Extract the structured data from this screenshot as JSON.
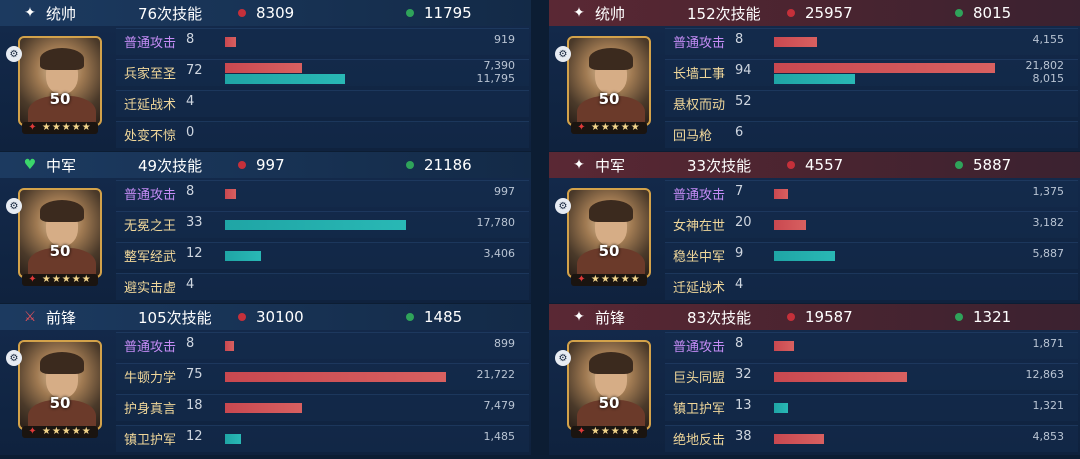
{
  "left": {
    "sections": [
      {
        "role": "统帅",
        "role_icon": "sparkle-icon",
        "skills_text": "76次技能",
        "damage": "8309",
        "heal": "11795",
        "level": "50",
        "stars": "★★★★★",
        "skills": [
          {
            "name": "普通攻击",
            "count": "8",
            "damage": "919",
            "heal": null,
            "damage_pct": 0.05,
            "heal_pct": 0,
            "style": "basic"
          },
          {
            "name": "兵家至圣",
            "count": "72",
            "damage": "7,390",
            "heal": "11,795",
            "damage_pct": 0.34,
            "heal_pct": 0.53,
            "style": "gold"
          },
          {
            "name": "迁延战术",
            "count": "4",
            "damage": null,
            "heal": null,
            "damage_pct": 0,
            "heal_pct": 0,
            "style": "gold"
          },
          {
            "name": "处变不惊",
            "count": "0",
            "damage": null,
            "heal": null,
            "damage_pct": 0,
            "heal_pct": 0,
            "style": "gold"
          }
        ]
      },
      {
        "role": "中军",
        "role_icon": "green-shield-icon",
        "skills_text": "49次技能",
        "damage": "997",
        "heal": "21186",
        "level": "50",
        "stars": "★★★★★",
        "skills": [
          {
            "name": "普通攻击",
            "count": "8",
            "damage": "997",
            "heal": null,
            "damage_pct": 0.05,
            "heal_pct": 0,
            "style": "basic"
          },
          {
            "name": "无冕之王",
            "count": "33",
            "damage": null,
            "heal": "17,780",
            "damage_pct": 0,
            "heal_pct": 0.8,
            "style": "gold"
          },
          {
            "name": "整军经武",
            "count": "12",
            "damage": null,
            "heal": "3,406",
            "damage_pct": 0,
            "heal_pct": 0.16,
            "style": "gold"
          },
          {
            "name": "避实击虚",
            "count": "4",
            "damage": null,
            "heal": null,
            "damage_pct": 0,
            "heal_pct": 0,
            "style": "gold"
          }
        ]
      },
      {
        "role": "前锋",
        "role_icon": "red-sword-icon",
        "skills_text": "105次技能",
        "damage": "30100",
        "heal": "1485",
        "level": "50",
        "stars": "★★★★★",
        "skills": [
          {
            "name": "普通攻击",
            "count": "8",
            "damage": "899",
            "heal": null,
            "damage_pct": 0.04,
            "heal_pct": 0,
            "style": "basic"
          },
          {
            "name": "牛顿力学",
            "count": "75",
            "damage": "21,722",
            "heal": null,
            "damage_pct": 0.98,
            "heal_pct": 0,
            "style": "gold"
          },
          {
            "name": "护身真言",
            "count": "18",
            "damage": "7,479",
            "heal": null,
            "damage_pct": 0.34,
            "heal_pct": 0,
            "style": "gold"
          },
          {
            "name": "镇卫护军",
            "count": "12",
            "damage": null,
            "heal": "1,485",
            "damage_pct": 0,
            "heal_pct": 0.07,
            "style": "gold"
          }
        ]
      }
    ]
  },
  "right": {
    "sections": [
      {
        "role": "统帅",
        "role_icon": "sparkle-icon",
        "skills_text": "152次技能",
        "damage": "25957",
        "heal": "8015",
        "level": "50",
        "stars": "★★★★★",
        "skills": [
          {
            "name": "普通攻击",
            "count": "8",
            "damage": "4,155",
            "heal": null,
            "damage_pct": 0.19,
            "heal_pct": 0,
            "style": "basic"
          },
          {
            "name": "长墙工事",
            "count": "94",
            "damage": "21,802",
            "heal": "8,015",
            "damage_pct": 0.98,
            "heal_pct": 0.36,
            "style": "gold"
          },
          {
            "name": "悬权而动",
            "count": "52",
            "damage": null,
            "heal": null,
            "damage_pct": 0,
            "heal_pct": 0,
            "style": "gold"
          },
          {
            "name": "回马枪",
            "count": "6",
            "damage": null,
            "heal": null,
            "damage_pct": 0,
            "heal_pct": 0,
            "style": "gold"
          }
        ]
      },
      {
        "role": "中军",
        "role_icon": "sparkle-icon",
        "skills_text": "33次技能",
        "damage": "4557",
        "heal": "5887",
        "level": "50",
        "stars": "★★★★★",
        "skills": [
          {
            "name": "普通攻击",
            "count": "7",
            "damage": "1,375",
            "heal": null,
            "damage_pct": 0.06,
            "heal_pct": 0,
            "style": "basic"
          },
          {
            "name": "女神在世",
            "count": "20",
            "damage": "3,182",
            "heal": null,
            "damage_pct": 0.14,
            "heal_pct": 0,
            "style": "gold"
          },
          {
            "name": "稳坐中军",
            "count": "9",
            "damage": null,
            "heal": "5,887",
            "damage_pct": 0,
            "heal_pct": 0.27,
            "style": "gold"
          },
          {
            "name": "迁延战术",
            "count": "4",
            "damage": null,
            "heal": null,
            "damage_pct": 0,
            "heal_pct": 0,
            "style": "gold"
          }
        ]
      },
      {
        "role": "前锋",
        "role_icon": "sparkle-icon",
        "skills_text": "83次技能",
        "damage": "19587",
        "heal": "1321",
        "level": "50",
        "stars": "★★★★★",
        "skills": [
          {
            "name": "普通攻击",
            "count": "8",
            "damage": "1,871",
            "heal": null,
            "damage_pct": 0.09,
            "heal_pct": 0,
            "style": "basic"
          },
          {
            "name": "巨头同盟",
            "count": "32",
            "damage": "12,863",
            "heal": null,
            "damage_pct": 0.59,
            "heal_pct": 0,
            "style": "gold"
          },
          {
            "name": "镇卫护军",
            "count": "13",
            "damage": null,
            "heal": "1,321",
            "damage_pct": 0,
            "heal_pct": 0.06,
            "style": "gold"
          },
          {
            "name": "绝地反击",
            "count": "38",
            "damage": "4,853",
            "heal": null,
            "damage_pct": 0.22,
            "heal_pct": 0,
            "style": "gold"
          }
        ]
      }
    ]
  }
}
